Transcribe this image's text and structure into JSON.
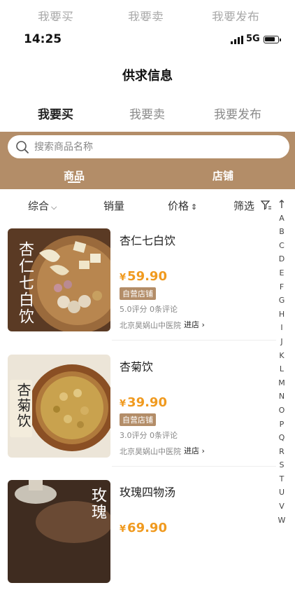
{
  "ghost_tabs": [
    "我要买",
    "我要卖",
    "我要发布"
  ],
  "status": {
    "time": "14:25",
    "network": "5G"
  },
  "nav": {
    "title": "供求信息"
  },
  "tabs": [
    "我要买",
    "我要卖",
    "我要发布"
  ],
  "search": {
    "placeholder": "搜索商品名称"
  },
  "sub_tabs": [
    "商品",
    "店铺"
  ],
  "filters": {
    "comprehensive": "综合",
    "sales": "销量",
    "price": "价格",
    "screen": "筛选"
  },
  "index": [
    "↑",
    "A",
    "B",
    "C",
    "D",
    "E",
    "F",
    "G",
    "H",
    "I",
    "J",
    "K",
    "L",
    "M",
    "N",
    "O",
    "P",
    "Q",
    "R",
    "S",
    "T",
    "U",
    "V",
    "W"
  ],
  "products": [
    {
      "name": "杏仁七白饮",
      "currency": "¥",
      "price": "59.90",
      "badge": "自营店铺",
      "rating": "5.0评分 0条评论",
      "shop": "北京昊娲山中医院",
      "enter": "进店",
      "image_label": "杏仁七白饮"
    },
    {
      "name": "杏菊饮",
      "currency": "¥",
      "price": "39.90",
      "badge": "自营店铺",
      "rating": "3.0评分 0条评论",
      "shop": "北京昊娲山中医院",
      "enter": "进店",
      "image_label": "杏菊饮"
    },
    {
      "name": "玫瑰四物汤",
      "currency": "¥",
      "price": "69.90",
      "image_label": "玫瑰"
    }
  ],
  "colors": {
    "brand": "#b38d68",
    "price": "#f09a1f"
  }
}
